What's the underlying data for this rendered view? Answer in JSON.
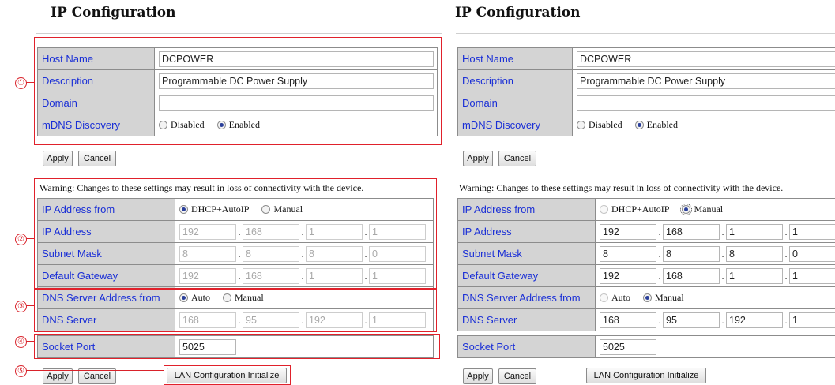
{
  "left": {
    "title": "IP Configuration",
    "host_name_label": "Host Name",
    "host_name_value": "DCPOWER",
    "description_label": "Description",
    "description_value": "Programmable DC Power Supply",
    "domain_label": "Domain",
    "domain_value": "",
    "mdns_label": "mDNS Discovery",
    "mdns_options": [
      "Disabled",
      "Enabled"
    ],
    "mdns_selected": "Enabled",
    "apply_label": "Apply",
    "cancel_label": "Cancel",
    "warning": "Warning: Changes to these settings may result in loss of connectivity with the device.",
    "ip_from_label": "IP Address from",
    "ip_from_options": [
      "DHCP+AutoIP",
      "Manual"
    ],
    "ip_from_selected": "DHCP+AutoIP",
    "ip_address_label": "IP Address",
    "ip_address": [
      "192",
      "168",
      "1",
      "1"
    ],
    "subnet_label": "Subnet Mask",
    "subnet": [
      "8",
      "8",
      "8",
      "0"
    ],
    "gateway_label": "Default Gateway",
    "gateway": [
      "192",
      "168",
      "1",
      "1"
    ],
    "dns_from_label": "DNS Server Address from",
    "dns_from_options": [
      "Auto",
      "Manual"
    ],
    "dns_from_selected": "Auto",
    "dns_server_label": "DNS Server",
    "dns_server": [
      "168",
      "95",
      "192",
      "1"
    ],
    "socket_port_label": "Socket Port",
    "socket_port_value": "5025",
    "apply2_label": "Apply",
    "cancel2_label": "Cancel",
    "lan_init_label": "LAN Configuration Initialize"
  },
  "right": {
    "title": "IP Configuration",
    "host_name_label": "Host Name",
    "host_name_value": "DCPOWER",
    "description_label": "Description",
    "description_value": "Programmable DC Power Supply",
    "domain_label": "Domain",
    "domain_value": "",
    "mdns_label": "mDNS Discovery",
    "mdns_options": [
      "Disabled",
      "Enabled"
    ],
    "mdns_selected": "Enabled",
    "apply_label": "Apply",
    "cancel_label": "Cancel",
    "warning": "Warning: Changes to these settings may result in loss of connectivity with the device.",
    "ip_from_label": "IP Address from",
    "ip_from_options": [
      "DHCP+AutoIP",
      "Manual"
    ],
    "ip_from_selected": "Manual",
    "ip_address_label": "IP Address",
    "ip_address": [
      "192",
      "168",
      "1",
      "1"
    ],
    "subnet_label": "Subnet Mask",
    "subnet": [
      "8",
      "8",
      "8",
      "0"
    ],
    "gateway_label": "Default Gateway",
    "gateway": [
      "192",
      "168",
      "1",
      "1"
    ],
    "dns_from_label": "DNS Server Address from",
    "dns_from_options": [
      "Auto",
      "Manual"
    ],
    "dns_from_selected": "Manual",
    "dns_server_label": "DNS Server",
    "dns_server": [
      "168",
      "95",
      "192",
      "1"
    ],
    "socket_port_label": "Socket Port",
    "socket_port_value": "5025",
    "apply2_label": "Apply",
    "cancel2_label": "Cancel",
    "lan_init_label": "LAN Configuration Initialize"
  },
  "callouts": [
    "①",
    "②",
    "③",
    "④",
    "⑤"
  ],
  "colors": {
    "label_text": "#1a2fd6",
    "label_bg": "#d4d4d4",
    "highlight_red": "#e0212b"
  }
}
